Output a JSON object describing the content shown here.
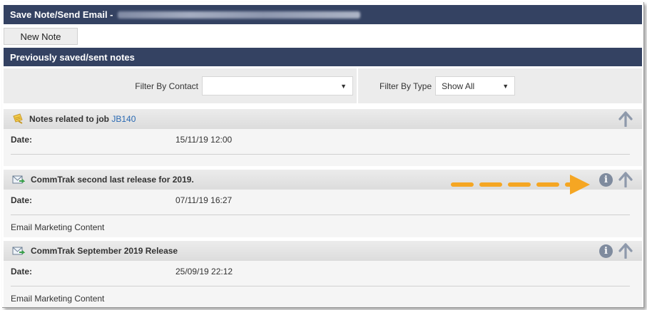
{
  "header": {
    "title": "Save Note/Send Email -"
  },
  "toolbar": {
    "new_note_label": "New Note"
  },
  "section": {
    "title": "Previously saved/sent notes"
  },
  "filters": {
    "contact_label": "Filter By Contact",
    "contact_value": "",
    "type_label": "Filter By Type",
    "type_value": "Show All"
  },
  "notes": [
    {
      "title_prefix": "Notes related to job",
      "job_link": "JB140",
      "icon": "note-icon",
      "date_label": "Date:",
      "date": "15/11/19 12:00",
      "content": "",
      "has_info": false
    },
    {
      "title": "CommTrak second last release for 2019.",
      "icon": "email-icon",
      "date_label": "Date:",
      "date": "07/11/19 16:27",
      "content": "Email Marketing Content",
      "has_info": true,
      "annotation": "orange-dashed-arrow"
    },
    {
      "title": "CommTrak September 2019 Release",
      "icon": "email-icon",
      "date_label": "Date:",
      "date": "25/09/19 22:12",
      "content": "Email Marketing Content",
      "has_info": true
    }
  ],
  "colors": {
    "header_bg": "#344262",
    "arrow": "#f5a623",
    "icon_gray": "#7f8b9e",
    "link": "#2a6ab3"
  }
}
